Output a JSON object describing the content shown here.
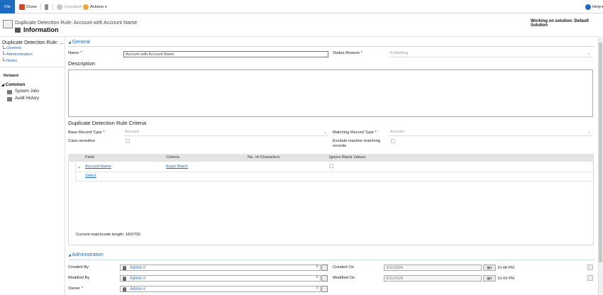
{
  "ribbon": {
    "file": "File",
    "close": "Close",
    "unpublish": "Unpublish",
    "actions": "Actions",
    "help": "Help"
  },
  "header": {
    "entity_title": "Duplicate Detection Rule: Account with Account Name",
    "form_name": "Information",
    "solution": "Working on solution: Default Solution"
  },
  "nav": {
    "title": "Duplicate Detection Rule: ...",
    "links": [
      "General",
      "Administration",
      "Notes"
    ],
    "related": "Related",
    "common": "Common",
    "common_items": [
      "System Jobs",
      "Audit History"
    ]
  },
  "general": {
    "heading": "General",
    "name_label": "Name",
    "name_value": "Account with Account Name",
    "status_label": "Status Reason",
    "status_value": "Publishing",
    "description_heading": "Description"
  },
  "criteria": {
    "heading": "Duplicate Detection Rule Criteria",
    "base_label": "Base Record Type",
    "base_value": "Account",
    "matching_label": "Matching Record Type",
    "matching_value": "Account",
    "case_label": "Case-sensitive",
    "exclude_label_1": "Exclude inactive matching",
    "exclude_label_2": "records",
    "columns": [
      "Field",
      "Criteria",
      "No. of Characters",
      "Ignore Blank Values"
    ],
    "rows": [
      {
        "field": "Account Name",
        "criteria": "Exact Match"
      }
    ],
    "select": "Select",
    "matchcode": "Current matchcode length: 160/700"
  },
  "admin": {
    "heading": "Administration",
    "created_by_label": "Created By",
    "created_by": "Admin #",
    "modified_by_label": "Modified By",
    "modified_by": "Admin #",
    "owner_label": "Owner",
    "owner": "Admin #",
    "created_on_label": "Created On",
    "created_on_date": "3/11/2024",
    "created_on_time": "10:48 PM",
    "modified_on_label": "Modified On",
    "modified_on_date": "3/11/2024",
    "modified_on_time": "10:49 PM"
  },
  "colors": {
    "accent": "#1f6ac1",
    "required": "#cc0000"
  }
}
